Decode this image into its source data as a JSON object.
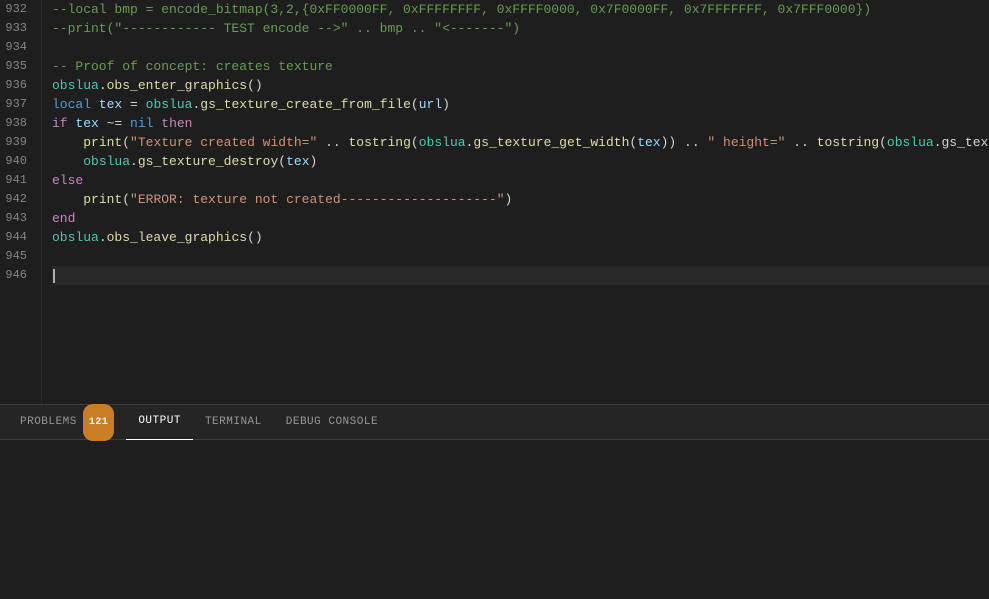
{
  "editor": {
    "background": "#1e1e1e",
    "lines": [
      {
        "number": "932",
        "tokens": [
          {
            "type": "comment",
            "text": "--local bmp = encode_bitmap(3,2,{0xFF0000FF, 0xFFFFFFFF, 0xFFFF0000, 0x7F0000FF, 0x7FFFFFFF, 0x7FFF0000})"
          }
        ]
      },
      {
        "number": "933",
        "tokens": [
          {
            "type": "comment",
            "text": "--print(\"------------ TEST encode -->\" .. bmp .. \"<-------\")"
          }
        ]
      },
      {
        "number": "934",
        "tokens": [
          {
            "type": "plain",
            "text": ""
          }
        ]
      },
      {
        "number": "935",
        "tokens": [
          {
            "type": "comment",
            "text": "-- Proof of concept: creates texture"
          }
        ]
      },
      {
        "number": "936",
        "tokens": [
          {
            "type": "obj",
            "text": "obslua"
          },
          {
            "type": "plain",
            "text": "."
          },
          {
            "type": "method",
            "text": "obs_enter_graphics"
          },
          {
            "type": "plain",
            "text": "()"
          }
        ]
      },
      {
        "number": "937",
        "tokens": [
          {
            "type": "keyword-local",
            "text": "local"
          },
          {
            "type": "plain",
            "text": " "
          },
          {
            "type": "variable",
            "text": "tex"
          },
          {
            "type": "plain",
            "text": " = "
          },
          {
            "type": "obj",
            "text": "obslua"
          },
          {
            "type": "plain",
            "text": "."
          },
          {
            "type": "method",
            "text": "gs_texture_create_from_file"
          },
          {
            "type": "plain",
            "text": "("
          },
          {
            "type": "variable",
            "text": "url"
          },
          {
            "type": "plain",
            "text": ")"
          }
        ]
      },
      {
        "number": "938",
        "tokens": [
          {
            "type": "keyword",
            "text": "if"
          },
          {
            "type": "plain",
            "text": " "
          },
          {
            "type": "variable",
            "text": "tex"
          },
          {
            "type": "plain",
            "text": " ~= "
          },
          {
            "type": "nil-val",
            "text": "nil"
          },
          {
            "type": "plain",
            "text": " "
          },
          {
            "type": "keyword",
            "text": "then"
          }
        ]
      },
      {
        "number": "939",
        "tokens": [
          {
            "type": "plain",
            "text": "    "
          },
          {
            "type": "method",
            "text": "print"
          },
          {
            "type": "plain",
            "text": "("
          },
          {
            "type": "string",
            "text": "\"Texture created width=\""
          },
          {
            "type": "plain",
            "text": " .. "
          },
          {
            "type": "method",
            "text": "tostring"
          },
          {
            "type": "plain",
            "text": "("
          },
          {
            "type": "obj",
            "text": "obslua"
          },
          {
            "type": "plain",
            "text": "."
          },
          {
            "type": "method",
            "text": "gs_texture_get_width"
          },
          {
            "type": "plain",
            "text": "("
          },
          {
            "type": "variable",
            "text": "tex"
          },
          {
            "type": "plain",
            "text": ")) .. "
          },
          {
            "type": "string",
            "text": "\" height=\""
          },
          {
            "type": "plain",
            "text": " .. "
          },
          {
            "type": "method",
            "text": "tostring"
          },
          {
            "type": "plain",
            "text": "("
          },
          {
            "type": "obj",
            "text": "obslua"
          },
          {
            "type": "plain",
            "text": ".gs_text"
          }
        ]
      },
      {
        "number": "940",
        "tokens": [
          {
            "type": "plain",
            "text": "    "
          },
          {
            "type": "obj",
            "text": "obslua"
          },
          {
            "type": "plain",
            "text": "."
          },
          {
            "type": "method",
            "text": "gs_texture_destroy"
          },
          {
            "type": "plain",
            "text": "("
          },
          {
            "type": "variable",
            "text": "tex"
          },
          {
            "type": "plain",
            "text": ")"
          }
        ]
      },
      {
        "number": "941",
        "tokens": [
          {
            "type": "keyword",
            "text": "else"
          }
        ]
      },
      {
        "number": "942",
        "tokens": [
          {
            "type": "plain",
            "text": "    "
          },
          {
            "type": "method",
            "text": "print"
          },
          {
            "type": "plain",
            "text": "("
          },
          {
            "type": "string",
            "text": "\"ERROR: texture not created--------------------\""
          },
          {
            "type": "plain",
            "text": ")"
          }
        ]
      },
      {
        "number": "943",
        "tokens": [
          {
            "type": "keyword",
            "text": "end"
          }
        ]
      },
      {
        "number": "944",
        "tokens": [
          {
            "type": "obj",
            "text": "obslua"
          },
          {
            "type": "plain",
            "text": "."
          },
          {
            "type": "method",
            "text": "obs_leave_graphics"
          },
          {
            "type": "plain",
            "text": "()"
          }
        ]
      },
      {
        "number": "945",
        "tokens": [
          {
            "type": "plain",
            "text": ""
          }
        ]
      },
      {
        "number": "946",
        "tokens": [
          {
            "type": "plain",
            "text": ""
          }
        ],
        "active": true
      }
    ]
  },
  "panel": {
    "tabs": [
      {
        "id": "problems",
        "label": "PROBLEMS",
        "badge": "121"
      },
      {
        "id": "output",
        "label": "OUTPUT",
        "active": true
      },
      {
        "id": "terminal",
        "label": "TERMINAL"
      },
      {
        "id": "debug-console",
        "label": "DEBUG CONSOLE"
      }
    ]
  },
  "colors": {
    "accent": "#c97e25",
    "active_tab_border": "#ffffff",
    "editor_bg": "#1e1e1e",
    "panel_bg": "#252526"
  }
}
